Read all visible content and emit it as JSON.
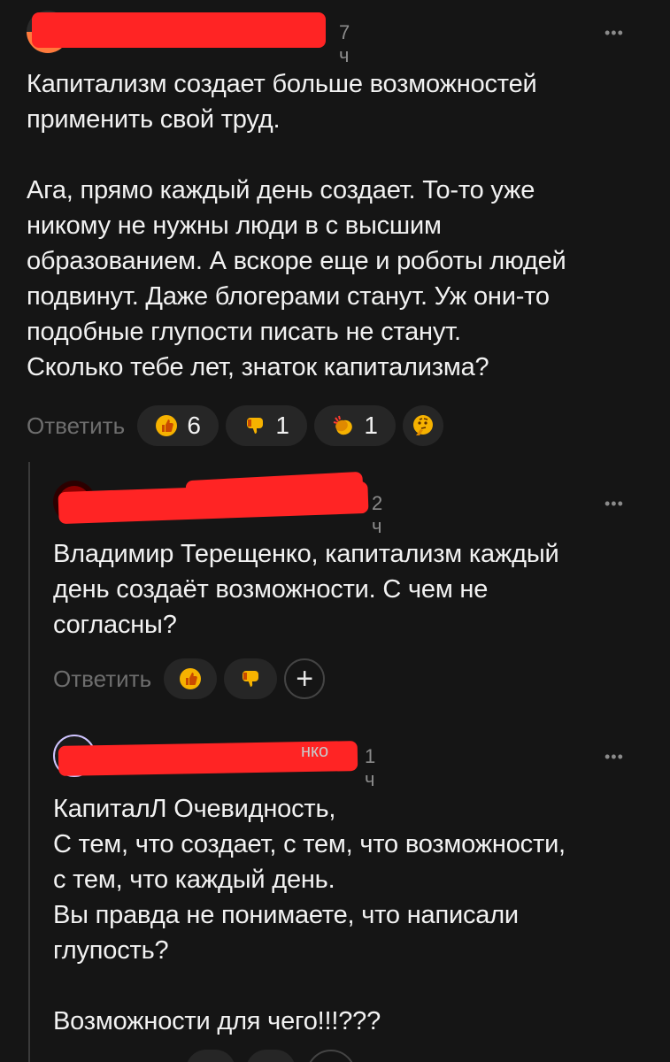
{
  "comments": [
    {
      "time": "7 ч",
      "more": "•••",
      "text": "Капитализм создает больше возможностей\nприменить свой труд.\n\nАга, прямо каждый день создает. То-то уже\nникому не нужны люди в с высшим\nобразованием. А вскоре еще и роботы людей\nподвинут. Даже блогерами станут. Уж они-то\nподобные глупости писать не станут.\nСколько тебе лет, знаток капитализма?",
      "reply_label": "Ответить",
      "reactions": [
        {
          "icon": "thumbs-up-icon",
          "count": "6"
        },
        {
          "icon": "thumbs-down-icon",
          "count": "1"
        },
        {
          "icon": "clapping-hands-icon",
          "count": "1"
        },
        {
          "icon": "thinking-face-icon",
          "count": ""
        }
      ]
    },
    {
      "time": "2 ч",
      "more": "•••",
      "text": "Владимир Терещенко, капитализм каждый\nдень создаёт возможности. С чем не\nсогласны?",
      "reply_label": "Ответить",
      "reactions": [
        {
          "icon": "thumbs-up-icon",
          "count": ""
        },
        {
          "icon": "thumbs-down-icon",
          "count": ""
        },
        {
          "icon": "add-reaction-icon",
          "count": "+"
        }
      ]
    },
    {
      "name_fragment": "нко",
      "time": "1 ч",
      "more": "•••",
      "text": "КапиталЛ Очевидность,\nС тем, что создает, с тем, что возможности,\nс тем, что каждый день.\nВы правда не понимаете, что написали\nглупость?\n\nВозможности для чего!!!???"
    }
  ],
  "colors": {
    "background": "#151515",
    "text": "#f2f2f2",
    "muted": "#8b8b8b",
    "pill": "#262626",
    "redaction": "#ff2424"
  }
}
